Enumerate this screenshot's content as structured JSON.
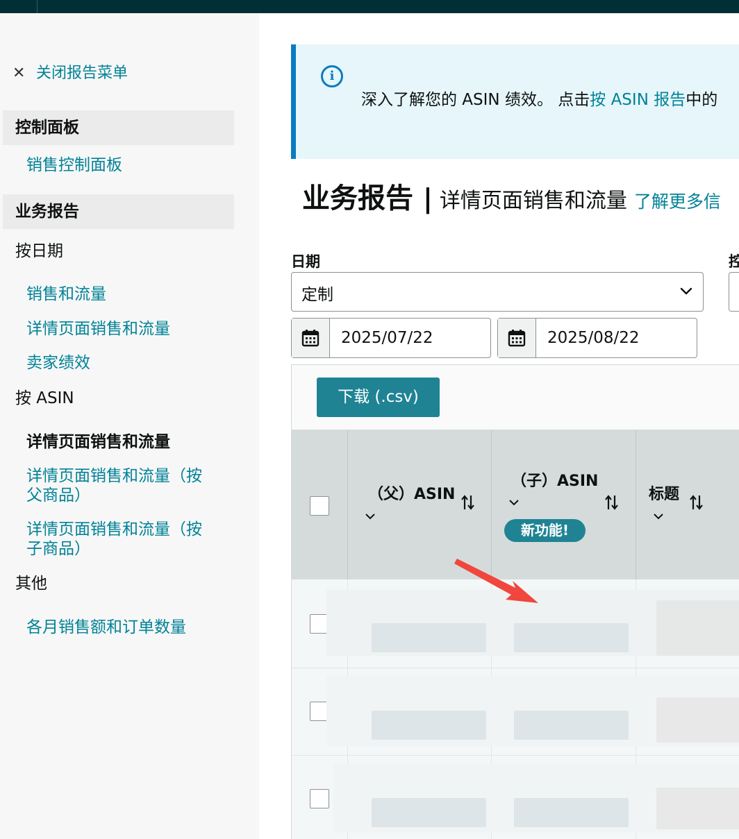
{
  "sidebar": {
    "close_label": "关闭报告菜单",
    "section_dashboard": "控制面板",
    "dashboard_link": "销售控制面板",
    "section_business": "业务报告",
    "group_by_date": "按日期",
    "by_date_links": [
      "销售和流量",
      "详情页面销售和流量",
      "卖家绩效"
    ],
    "group_by_asin": "按 ASIN",
    "active_item": "详情页面销售和流量",
    "by_asin_links": [
      [
        "详情页面销售和流量（按",
        "父商品）"
      ],
      [
        "详情页面销售和流量（按",
        "子商品）"
      ]
    ],
    "group_other": "其他",
    "other_link": "各月销售额和订单数量"
  },
  "info": {
    "text_before": "深入了解您的 ASIN 绩效。 点击",
    "link": "按 ASIN 报告",
    "text_after": "中的"
  },
  "title": {
    "main": "业务报告",
    "separator": "|",
    "sub": "详情页面销售和流量",
    "learn_more": "了解更多信"
  },
  "filters": {
    "date_label": "日期",
    "cut_label": "控",
    "date_select": "定制",
    "start_date": "2025/07/22",
    "end_date": "2025/08/22"
  },
  "table": {
    "download_label": "下载 (.csv)",
    "columns": [
      "（父）ASIN",
      "（子）ASIN",
      "标题"
    ],
    "new_badge": "新功能!"
  },
  "colors": {
    "topbar": "#002f36",
    "link": "#008296",
    "button": "#1f8394",
    "info_accent": "#0a7bc1",
    "arrow": "#f0463e"
  }
}
